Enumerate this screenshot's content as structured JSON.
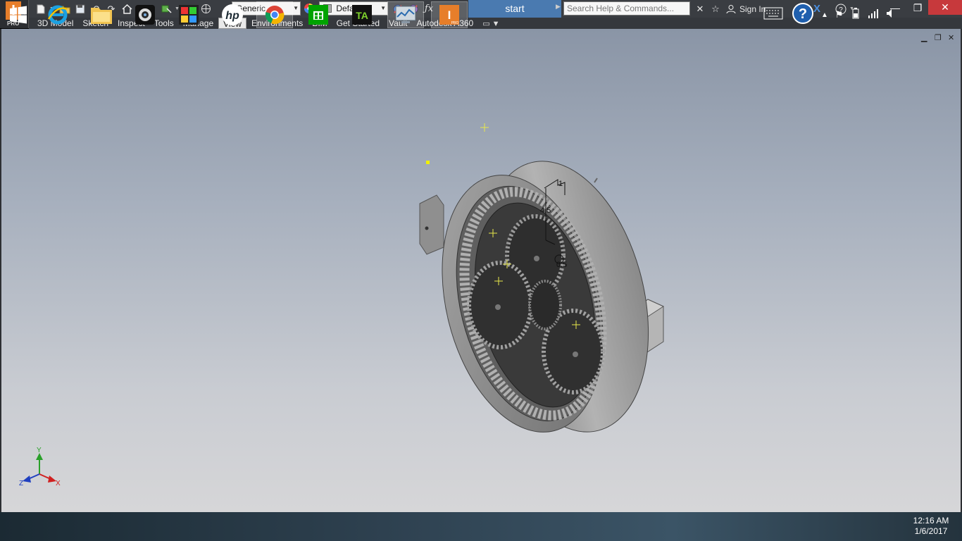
{
  "app": {
    "logo_letter": "I",
    "logo_badge": "PRO",
    "document_title": "start"
  },
  "quick_access": {
    "material_value": "Generic",
    "appearance_value": "Default",
    "search_placeholder": "Search Help & Commands...",
    "sign_in_label": "Sign In"
  },
  "ribbon_tabs": [
    {
      "label": "3D Model",
      "active": false
    },
    {
      "label": "Sketch",
      "active": false
    },
    {
      "label": "Inspect",
      "active": false
    },
    {
      "label": "Tools",
      "active": false
    },
    {
      "label": "Manage",
      "active": false
    },
    {
      "label": "View",
      "active": true
    },
    {
      "label": "Environments",
      "active": false
    },
    {
      "label": "BIM",
      "active": false
    },
    {
      "label": "Get Started",
      "active": false
    },
    {
      "label": "Vault",
      "active": false
    },
    {
      "label": "Autodesk A360",
      "active": false
    }
  ],
  "viewport": {
    "dimension_1": "1",
    "dimension_2": "4.5",
    "dimension_3": "0.5",
    "axis_x": "X",
    "axis_y": "Y",
    "axis_z": "Z"
  },
  "taskbar": {
    "apps": [
      "start-button",
      "internet-explorer",
      "file-explorer",
      "webcam",
      "puzzle-app",
      "hp",
      "chrome",
      "store",
      "camtasia",
      "task-manager",
      "inventor"
    ],
    "clock_time": "12:16 AM",
    "clock_date": "1/6/2017"
  },
  "colors": {
    "title_active": "#4a7ab0",
    "close_button": "#c7393c",
    "logo_orange": "#e77e2a",
    "model_gray": "#9a9a9a"
  }
}
